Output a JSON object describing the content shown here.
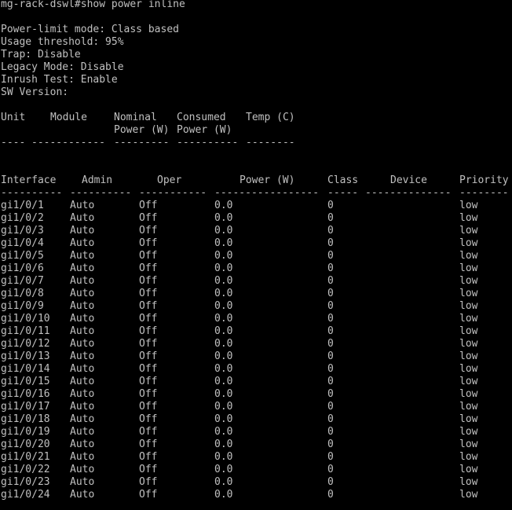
{
  "terminal": {
    "prompt": "mg-rack-dswl#show power inline",
    "summary": [
      "Power-limit mode: Class based",
      "Usage threshold: 95%",
      "Trap: Disable",
      "Legacy Mode: Disable",
      "Inrush Test: Enable",
      "SW Version:"
    ],
    "unit_table": {
      "headers": {
        "unit": "Unit",
        "module": "Module",
        "nominal": "Nominal",
        "nominal_sub": "Power (W)",
        "consumed": "Consumed",
        "consumed_sub": "Power (W)",
        "temp": "Temp (C)"
      },
      "separator": {
        "unit": "----",
        "module": "------------",
        "nominal": "---------",
        "consumed": "----------",
        "temp": "--------"
      }
    },
    "port_table": {
      "headers": {
        "interface": "Interface",
        "admin": "Admin",
        "oper": "Oper",
        "power": "Power (W)",
        "class": "Class",
        "device": "Device",
        "priority": "Priority"
      },
      "separator": {
        "interface": "----------",
        "admin": "----------",
        "oper": "-----------",
        "power": "-----------------",
        "class": "-----",
        "device": "--------------",
        "priority": "--------"
      },
      "rows": [
        {
          "interface": "gi1/0/1",
          "admin": "Auto",
          "oper": "Off",
          "power": "0.0",
          "class": "0",
          "device": "",
          "priority": "low"
        },
        {
          "interface": "gi1/0/2",
          "admin": "Auto",
          "oper": "Off",
          "power": "0.0",
          "class": "0",
          "device": "",
          "priority": "low"
        },
        {
          "interface": "gi1/0/3",
          "admin": "Auto",
          "oper": "Off",
          "power": "0.0",
          "class": "0",
          "device": "",
          "priority": "low"
        },
        {
          "interface": "gi1/0/4",
          "admin": "Auto",
          "oper": "Off",
          "power": "0.0",
          "class": "0",
          "device": "",
          "priority": "low"
        },
        {
          "interface": "gi1/0/5",
          "admin": "Auto",
          "oper": "Off",
          "power": "0.0",
          "class": "0",
          "device": "",
          "priority": "low"
        },
        {
          "interface": "gi1/0/6",
          "admin": "Auto",
          "oper": "Off",
          "power": "0.0",
          "class": "0",
          "device": "",
          "priority": "low"
        },
        {
          "interface": "gi1/0/7",
          "admin": "Auto",
          "oper": "Off",
          "power": "0.0",
          "class": "0",
          "device": "",
          "priority": "low"
        },
        {
          "interface": "gi1/0/8",
          "admin": "Auto",
          "oper": "Off",
          "power": "0.0",
          "class": "0",
          "device": "",
          "priority": "low"
        },
        {
          "interface": "gi1/0/9",
          "admin": "Auto",
          "oper": "Off",
          "power": "0.0",
          "class": "0",
          "device": "",
          "priority": "low"
        },
        {
          "interface": "gi1/0/10",
          "admin": "Auto",
          "oper": "Off",
          "power": "0.0",
          "class": "0",
          "device": "",
          "priority": "low"
        },
        {
          "interface": "gi1/0/11",
          "admin": "Auto",
          "oper": "Off",
          "power": "0.0",
          "class": "0",
          "device": "",
          "priority": "low"
        },
        {
          "interface": "gi1/0/12",
          "admin": "Auto",
          "oper": "Off",
          "power": "0.0",
          "class": "0",
          "device": "",
          "priority": "low"
        },
        {
          "interface": "gi1/0/13",
          "admin": "Auto",
          "oper": "Off",
          "power": "0.0",
          "class": "0",
          "device": "",
          "priority": "low"
        },
        {
          "interface": "gi1/0/14",
          "admin": "Auto",
          "oper": "Off",
          "power": "0.0",
          "class": "0",
          "device": "",
          "priority": "low"
        },
        {
          "interface": "gi1/0/15",
          "admin": "Auto",
          "oper": "Off",
          "power": "0.0",
          "class": "0",
          "device": "",
          "priority": "low"
        },
        {
          "interface": "gi1/0/16",
          "admin": "Auto",
          "oper": "Off",
          "power": "0.0",
          "class": "0",
          "device": "",
          "priority": "low"
        },
        {
          "interface": "gi1/0/17",
          "admin": "Auto",
          "oper": "Off",
          "power": "0.0",
          "class": "0",
          "device": "",
          "priority": "low"
        },
        {
          "interface": "gi1/0/18",
          "admin": "Auto",
          "oper": "Off",
          "power": "0.0",
          "class": "0",
          "device": "",
          "priority": "low"
        },
        {
          "interface": "gi1/0/19",
          "admin": "Auto",
          "oper": "Off",
          "power": "0.0",
          "class": "0",
          "device": "",
          "priority": "low"
        },
        {
          "interface": "gi1/0/20",
          "admin": "Auto",
          "oper": "Off",
          "power": "0.0",
          "class": "0",
          "device": "",
          "priority": "low"
        },
        {
          "interface": "gi1/0/21",
          "admin": "Auto",
          "oper": "Off",
          "power": "0.0",
          "class": "0",
          "device": "",
          "priority": "low"
        },
        {
          "interface": "gi1/0/22",
          "admin": "Auto",
          "oper": "Off",
          "power": "0.0",
          "class": "0",
          "device": "",
          "priority": "low"
        },
        {
          "interface": "gi1/0/23",
          "admin": "Auto",
          "oper": "Off",
          "power": "0.0",
          "class": "0",
          "device": "",
          "priority": "low"
        },
        {
          "interface": "gi1/0/24",
          "admin": "Auto",
          "oper": "Off",
          "power": "0.0",
          "class": "0",
          "device": "",
          "priority": "low"
        }
      ]
    },
    "colors": {
      "background": "#000000",
      "foreground": "#c0c0c0"
    }
  }
}
